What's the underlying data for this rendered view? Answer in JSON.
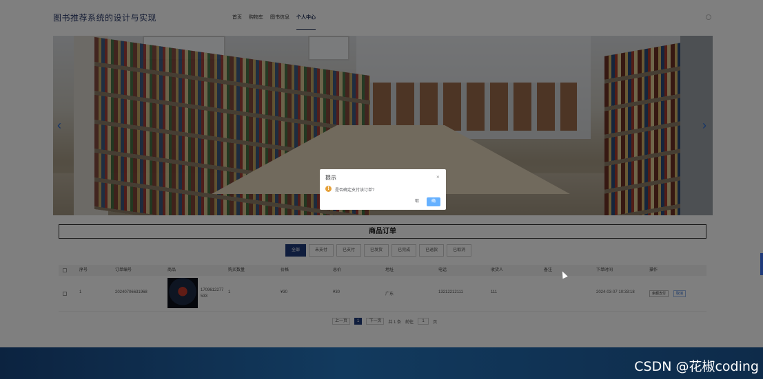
{
  "header": {
    "site_title": "图书推荐系统的设计与实现",
    "nav": [
      "首页",
      "购物车",
      "图书信息",
      "个人中心"
    ],
    "active_nav": "个人中心"
  },
  "orders": {
    "title": "商品订单",
    "filters": [
      "全部",
      "未支付",
      "已支付",
      "已发货",
      "已完成",
      "已退款",
      "已取消"
    ],
    "active_filter": "全部",
    "columns": [
      "序号",
      "订单编号",
      "商品",
      "购买数量",
      "价格",
      "总价",
      "地址",
      "电话",
      "收货人",
      "备注",
      "下单时间",
      "操作"
    ],
    "rows": [
      {
        "index": "1",
        "order_no": "20240706631968",
        "product_text": "1709612277533",
        "quantity": "1",
        "price": "¥30",
        "total": "¥30",
        "address": "广东",
        "phone": "13212212111",
        "receiver": "111",
        "remark": "",
        "time": "2024-03-07 10:33:18",
        "actions": [
          "余额支付",
          "取消"
        ]
      }
    ],
    "pagination": {
      "prev": "上一页",
      "current": "1",
      "next": "下一页",
      "total": "共 1 条",
      "goto_label": "前往",
      "goto_value": "1",
      "page_unit": "页"
    }
  },
  "dialog": {
    "title": "提示",
    "close": "×",
    "icon": "warning-icon",
    "message": "是否确定支付该订单?",
    "cancel": "取",
    "confirm": "确"
  },
  "watermark": "CSDN @花椒coding",
  "colors": {
    "primary": "#1f3a7a",
    "confirm_button": "#66b1ff",
    "warning": "#e6a23c",
    "footer": "#0c2340"
  }
}
